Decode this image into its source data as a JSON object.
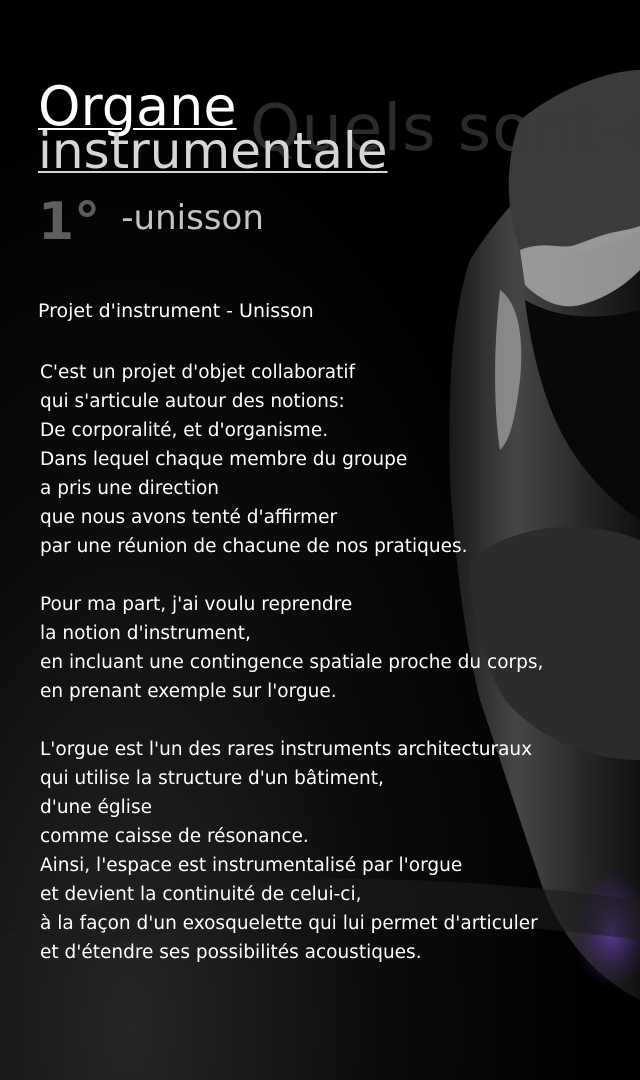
{
  "header": {
    "ghost_text": "Quels sont-el",
    "title_line_1": "Organe",
    "title_line_2": "instrumentale",
    "number": "1°",
    "label": "-unisson"
  },
  "project": {
    "title": "Projet d'instrument - Unisson"
  },
  "paragraphs": [
    {
      "lines": [
        "C'est un projet d'objet collaboratif",
        "qui s'articule autour des notions:",
        "De corporalité, et d'organisme.",
        "Dans lequel chaque membre du groupe",
        "a pris une direction",
        "que nous avons tenté d'affirmer",
        "par une réunion de chacune de nos pratiques."
      ]
    },
    {
      "lines": [
        "Pour ma part, j'ai voulu reprendre",
        "la notion d'instrument,",
        "en incluant une contingence spatiale proche du corps,",
        "en prenant exemple sur l'orgue."
      ]
    },
    {
      "lines": [
        "L'orgue est l'un des rares instruments architecturaux",
        "qui utilise la structure d'un bâtiment,",
        "d'une église",
        "comme caisse de résonance.",
        "Ainsi, l'espace est instrumentalisé par l'orgue",
        "et devient la continuité de celui-ci,",
        "à la façon d'un exosquelette qui lui permet d'articuler",
        "et d'étendre ses possibilités acoustiques."
      ]
    }
  ],
  "colors": {
    "background": "#000000",
    "text": "#ffffff",
    "accent_purple": "#5b3a96"
  }
}
